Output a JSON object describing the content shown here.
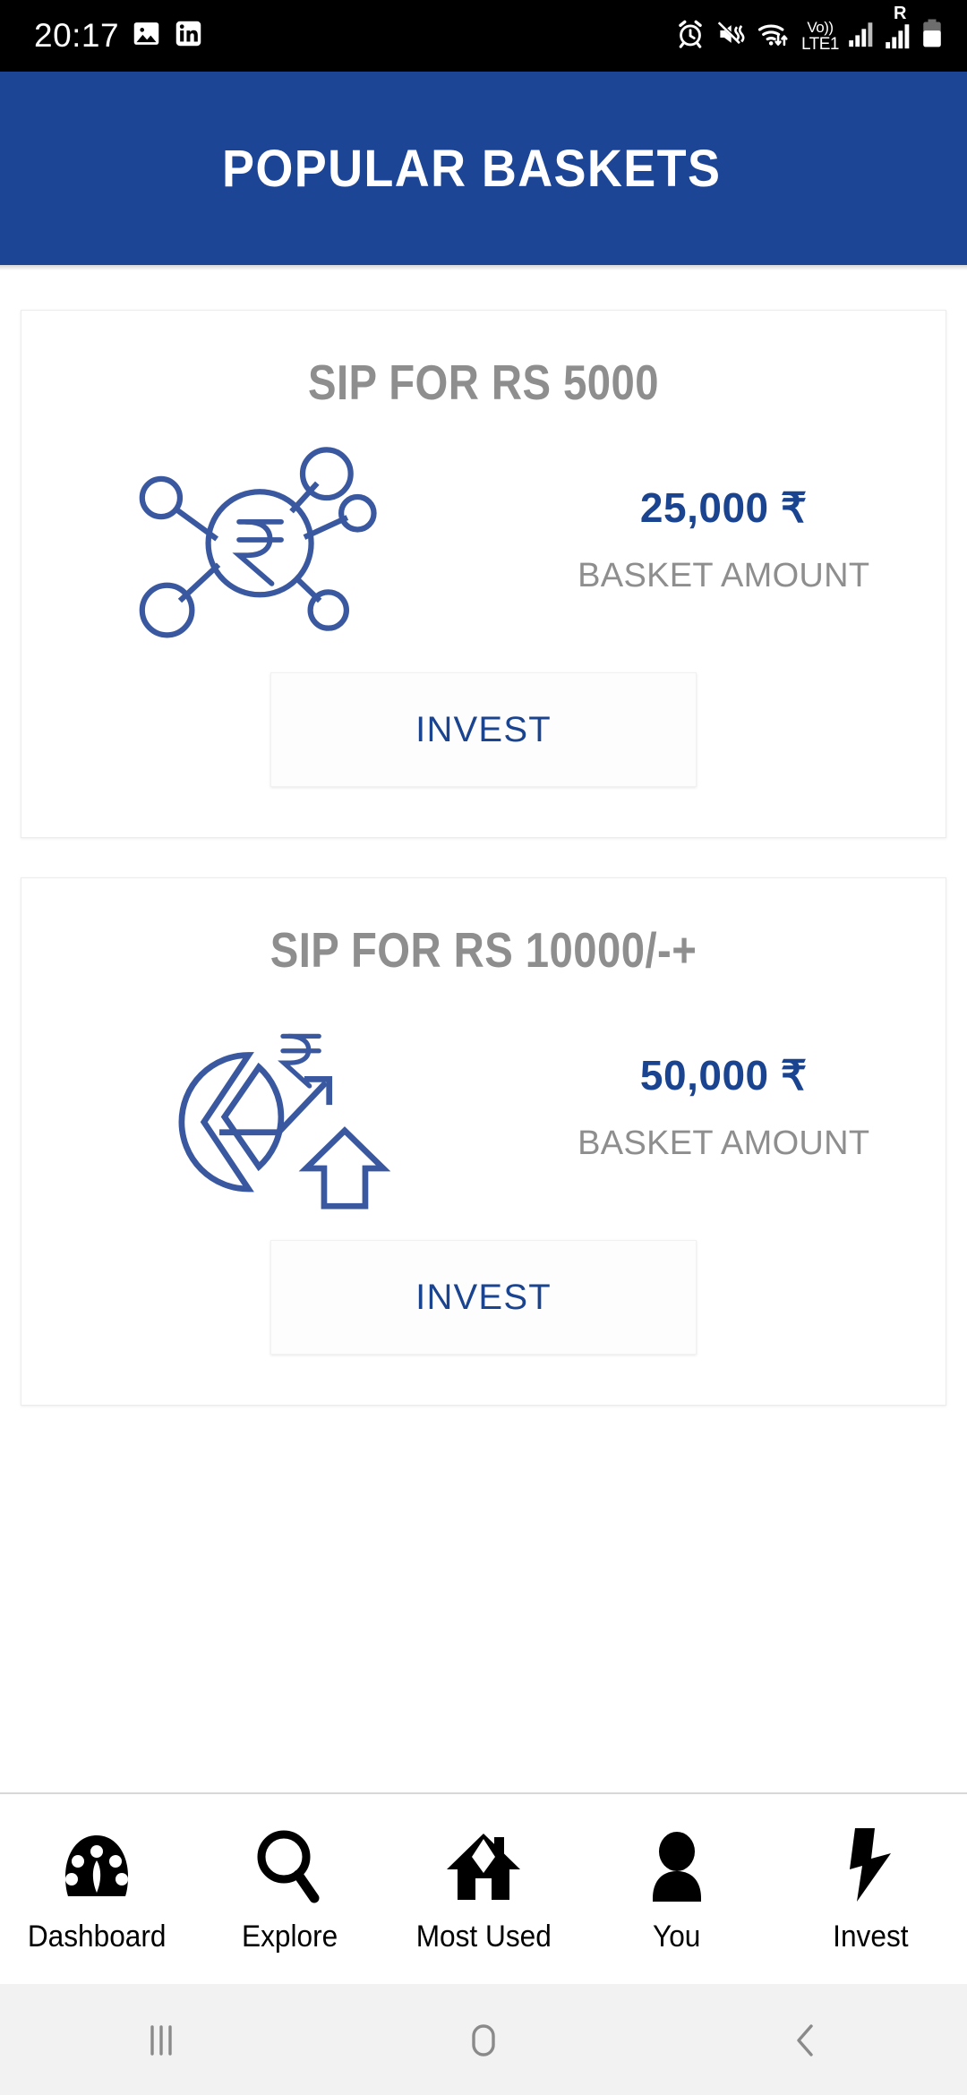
{
  "status_bar": {
    "time": "20:17",
    "left_icons": [
      "image-icon",
      "linkedin-icon"
    ],
    "right_icons": [
      "alarm-icon",
      "vibrate-mute-icon",
      "wifi-data-icon",
      "signal-icon",
      "roaming-signal-icon",
      "battery-icon"
    ],
    "volte_top": "Vo))",
    "volte_bottom": "LTE1",
    "roaming_letter": "R"
  },
  "app_bar": {
    "title": "POPULAR BASKETS",
    "background_color": "#1c4596",
    "text_color": "#ffffff"
  },
  "colors": {
    "brand_blue": "#1c4596",
    "amount_blue": "#1a4490",
    "muted_gray": "#8e8e8e",
    "card_border": "#ececec"
  },
  "baskets": [
    {
      "title": "SIP FOR RS 5000",
      "icon": "rupee-network-icon",
      "amount": "25,000 ₹",
      "amount_label": "BASKET AMOUNT",
      "cta": "INVEST"
    },
    {
      "title": "SIP FOR RS 10000/-+",
      "icon": "pie-chart-growth-icon",
      "amount": "50,000 ₹",
      "amount_label": "BASKET AMOUNT",
      "cta": "INVEST"
    }
  ],
  "bottom_nav": {
    "items": [
      {
        "label": "Dashboard",
        "icon": "speedometer-icon"
      },
      {
        "label": "Explore",
        "icon": "search-icon"
      },
      {
        "label": "Most Used",
        "icon": "home-icon"
      },
      {
        "label": "You",
        "icon": "person-icon"
      },
      {
        "label": "Invest",
        "icon": "lightning-bolt-icon"
      }
    ]
  },
  "android_nav": {
    "recents": "recents-icon",
    "home": "home-pill-icon",
    "back": "back-chevron-icon"
  }
}
